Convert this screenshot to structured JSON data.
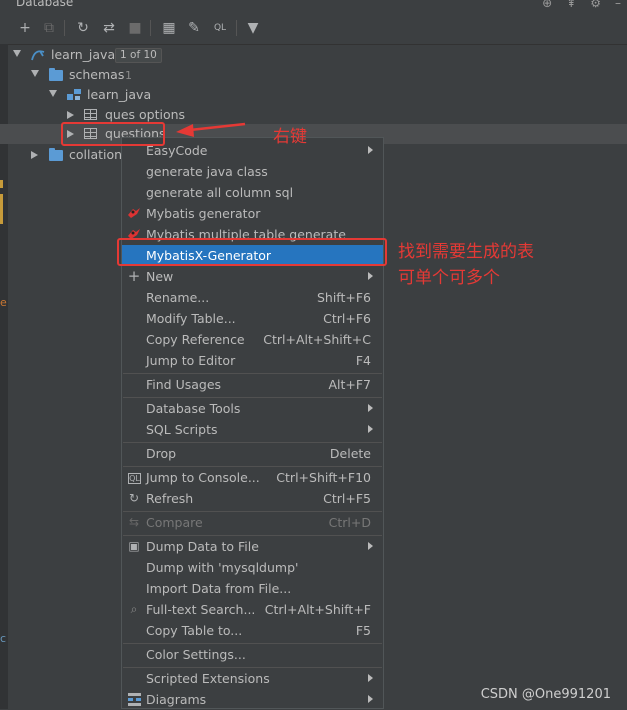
{
  "window": {
    "title": "Database"
  },
  "tree": {
    "root": {
      "label": "learn_java",
      "badge": "1 of 10"
    },
    "schemas": {
      "label": "schemas",
      "count": "1"
    },
    "schema": {
      "label": "learn_java"
    },
    "table1": {
      "label": "ques options"
    },
    "table2": {
      "label": "questions"
    },
    "collations": {
      "label": "collations"
    }
  },
  "menu": {
    "easycode": "EasyCode",
    "gen_java": "generate java class",
    "gen_sql": "generate all column sql",
    "mybatis_gen": "Mybatis generator",
    "mybatis_multi": "Mybatis multiple table generate",
    "mybatisx": "MybatisX-Generator",
    "new": "New",
    "rename": {
      "label": "Rename...",
      "shortcut": "Shift+F6"
    },
    "modify": {
      "label": "Modify Table...",
      "shortcut": "Ctrl+F6"
    },
    "copyref": {
      "label": "Copy Reference",
      "shortcut": "Ctrl+Alt+Shift+C"
    },
    "jump_editor": {
      "label": "Jump to Editor",
      "shortcut": "F4"
    },
    "find_usages": {
      "label": "Find Usages",
      "shortcut": "Alt+F7"
    },
    "db_tools": "Database Tools",
    "sql_scripts": "SQL Scripts",
    "drop": {
      "label": "Drop",
      "shortcut": "Delete"
    },
    "jump_console": {
      "label": "Jump to Console...",
      "shortcut": "Ctrl+Shift+F10"
    },
    "refresh": {
      "label": "Refresh",
      "shortcut": "Ctrl+F5"
    },
    "compare": {
      "label": "Compare",
      "shortcut": "Ctrl+D"
    },
    "dump_file": "Dump Data to File",
    "dump_mysql": "Dump with 'mysqldump'",
    "import": "Import Data from File...",
    "fulltext": {
      "label": "Full-text Search...",
      "shortcut": "Ctrl+Alt+Shift+F"
    },
    "copy_table": {
      "label": "Copy Table to...",
      "shortcut": "F5"
    },
    "color": "Color Settings...",
    "scripted": "Scripted Extensions",
    "diagrams": "Diagrams"
  },
  "annotations": {
    "right_click": "右键",
    "find_tables_1": "找到需要生成的表",
    "find_tables_2": "可单个可多个"
  },
  "watermark": "CSDN @One991201",
  "side_fragments": {
    "a": "e",
    "b": "c"
  },
  "colors": {
    "highlight": "#2675bf",
    "annotation": "#e53935",
    "background": "#3c3f41"
  }
}
